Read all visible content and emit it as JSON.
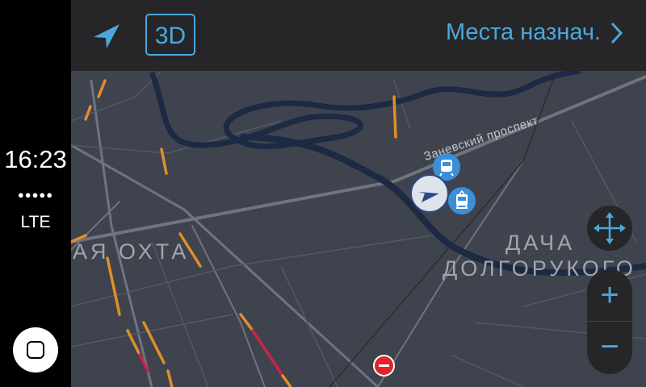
{
  "status": {
    "time": "16:23",
    "signal": "●●●●●",
    "network": "LTE"
  },
  "toolbar": {
    "mode_3d_label": "3D",
    "destinations_label": "Места назнач."
  },
  "map": {
    "street_label": "Заневский проспект",
    "district_labels": [
      "АЯ ОХТА",
      "ДАЧА",
      "ДОЛГОРУКОГО"
    ]
  },
  "controls": {
    "zoom_in": "+",
    "zoom_out": "−"
  },
  "colors": {
    "accent": "#4aa8dc",
    "map_bg": "#3f434e",
    "river": "#1c2a44",
    "traffic_slow": "#e08f2a",
    "traffic_heavy": "#c8244c"
  },
  "icons": [
    "navigation-arrow-icon",
    "chevron-right-icon",
    "pan-arrows-icon",
    "train-icon",
    "tram-icon",
    "no-entry-icon",
    "current-location-icon",
    "home-icon"
  ]
}
